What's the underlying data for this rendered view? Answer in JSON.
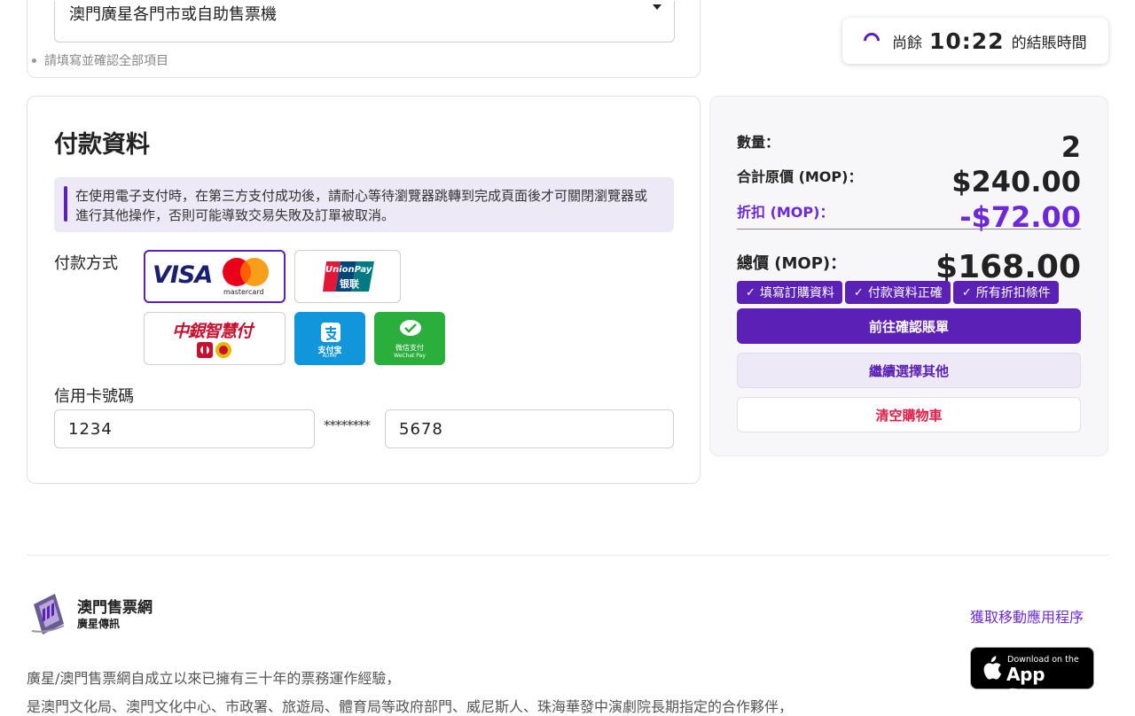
{
  "pickup": {
    "select_value": "澳門廣星各門市或自助售票機",
    "hint": "請填寫並確認全部項目"
  },
  "timer": {
    "prefix": "尚餘",
    "time": "10:22",
    "suffix": "的結賬時間"
  },
  "payment": {
    "title": "付款資料",
    "notice": "在使用電子支付時，在第三方支付成功後，請耐心等待瀏覽器跳轉到完成頁面後才可關閉瀏覽器或進行其他操作，否則可能導致交易失敗及訂單被取消。",
    "method_label": "付款方式",
    "methods": [
      {
        "name": "visa-mastercard",
        "visa_text": "VISA",
        "mc_text": "mastercard",
        "selected": true
      },
      {
        "name": "unionpay",
        "text": "UnionPay",
        "sub": "银联",
        "selected": false
      },
      {
        "name": "boc-smart-pay",
        "text": "中銀智慧付",
        "selected": false
      },
      {
        "name": "alipay",
        "text": "支付宝",
        "sub": "ALIPAY",
        "selected": false
      },
      {
        "name": "wechat-pay",
        "text": "微信支付",
        "sub": "WeChat Pay",
        "selected": false
      }
    ],
    "card_label": "信用卡號碼",
    "card_first": "1234",
    "card_mask": "********",
    "card_last": "5678"
  },
  "summary": {
    "qty_label": "數量：",
    "qty_value": "2",
    "subtotal_label": "合計原價 (MOP)：",
    "subtotal_value": "$240.00",
    "discount_label": "折扣 (MOP)：",
    "discount_value": "-$72.00",
    "total_label": "總價 (MOP)：",
    "total_value": "$168.00",
    "checks": [
      "填寫訂購資料",
      "付款資料正確",
      "所有折扣條件"
    ],
    "confirm_button": "前往確認賬單",
    "continue_button": "繼續選擇其他",
    "clear_button": "清空購物車"
  },
  "footer": {
    "brand": "澳門售票網",
    "brand_sub": "廣星傳訊",
    "app_link": "獲取移動應用程序",
    "appstore_small": "Download on the",
    "appstore_big": "App Store",
    "about_1": "廣星/澳門售票網自成立以來已擁有三十年的票務運作經驗，",
    "about_2": "是澳門文化局、澳門文化中心、市政署、旅遊局、體育局等政府部門、威尼斯人、珠海華發中演劇院長期指定的合作夥伴，"
  },
  "colors": {
    "accent": "#5b21b6",
    "discount": "#6d28d9",
    "danger": "#e11d48",
    "alipay": "#1296db",
    "wechat": "#2aae3c"
  }
}
